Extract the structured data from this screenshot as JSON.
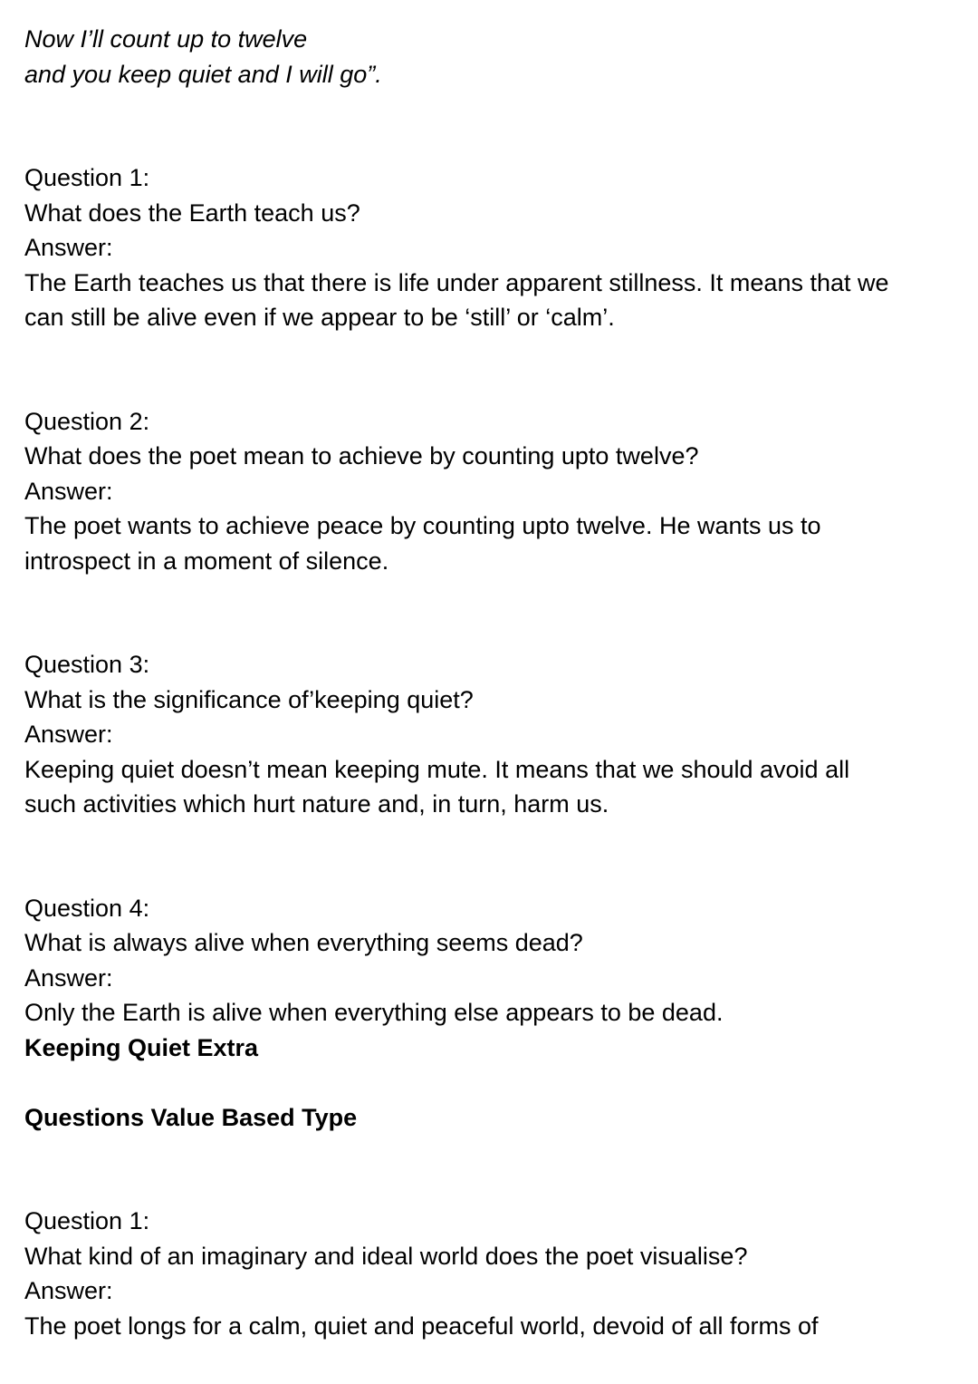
{
  "poem": {
    "line1": "Now I’ll count up to twelve",
    "line2": "and you keep quiet and I will go”."
  },
  "qa1": [
    {
      "q_label": "Question 1:",
      "q_text": "What does the Earth teach us?",
      "a_label": "Answer:",
      "a_lines": [
        "The Earth teaches us that there is life under apparent stillness. It means that we",
        "can still be alive even if we appear to be ‘still’ or ‘calm’."
      ]
    },
    {
      "q_label": "Question 2:",
      "q_text": "What does the poet mean to achieve by counting upto twelve?",
      "a_label": "Answer:",
      "a_lines": [
        "The poet wants to achieve peace by counting upto twelve. He wants us to",
        "introspect in a moment of silence."
      ]
    },
    {
      "q_label": "Question 3:",
      "q_text": "What is the significance of’keeping quiet?",
      "a_label": "Answer:",
      "a_lines": [
        "Keeping quiet doesn’t mean keeping mute. It means that we should avoid all",
        "such activities which hurt nature and, in turn, harm us."
      ]
    },
    {
      "q_label": "Question 4:",
      "q_text": "What is always alive when everything seems dead?",
      "a_label": "Answer:",
      "a_lines": [
        "Only the Earth is alive when everything else appears to be dead."
      ]
    }
  ],
  "section": {
    "heading1": "Keeping Quiet Extra",
    "heading2": "Questions Value Based Type"
  },
  "qa2": {
    "q_label": "Question 1:",
    "q_text": "What kind of an imaginary and ideal world does the poet visualise?",
    "a_label": "Answer:",
    "a_line": "The poet longs for a calm, quiet and peaceful world, devoid of all forms of"
  }
}
